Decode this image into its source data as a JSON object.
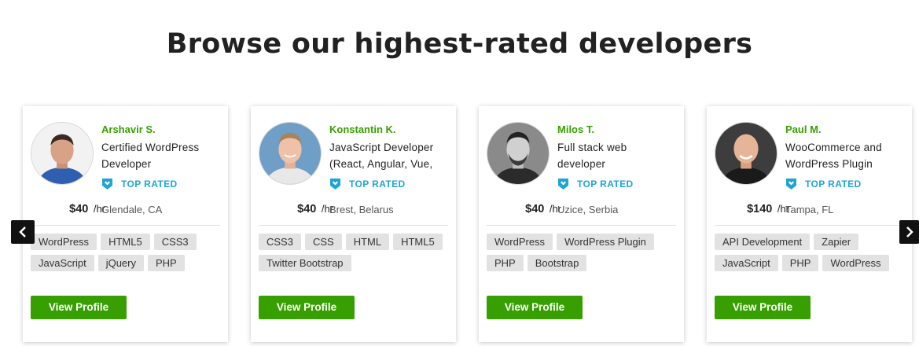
{
  "heading": "Browse our highest-rated developers",
  "badge_label": "TOP RATED",
  "rate_unit": "/hr",
  "view_profile_label": "View Profile",
  "colors": {
    "accent": "#37a000",
    "badge": "#1ea5d6"
  },
  "icons": {
    "prev": "chevron-left-icon",
    "next": "chevron-right-icon",
    "badge": "top-rated-shield-icon"
  },
  "developers": [
    {
      "name": "Arshavir S.",
      "title": "Certified WordPress Developer",
      "rate": "$40",
      "location": "Glendale, CA",
      "skills": [
        "WordPress",
        "HTML5",
        "CSS3",
        "JavaScript",
        "jQuery",
        "PHP"
      ]
    },
    {
      "name": "Konstantin K.",
      "title": "JavaScript Developer (React, Angular, Vue,",
      "rate": "$40",
      "location": "Brest, Belarus",
      "skills": [
        "CSS3",
        "CSS",
        "HTML",
        "HTML5",
        "Twitter Bootstrap"
      ]
    },
    {
      "name": "Milos T.",
      "title": "Full stack web developer",
      "rate": "$40",
      "location": "Uzice, Serbia",
      "skills": [
        "WordPress",
        "WordPress Plugin",
        "PHP",
        "Bootstrap"
      ]
    },
    {
      "name": "Paul M.",
      "title": "WooCommerce and WordPress Plugin",
      "rate": "$140",
      "location": "Tampa, FL",
      "skills": [
        "API Development",
        "Zapier",
        "JavaScript",
        "PHP",
        "WordPress"
      ]
    }
  ]
}
